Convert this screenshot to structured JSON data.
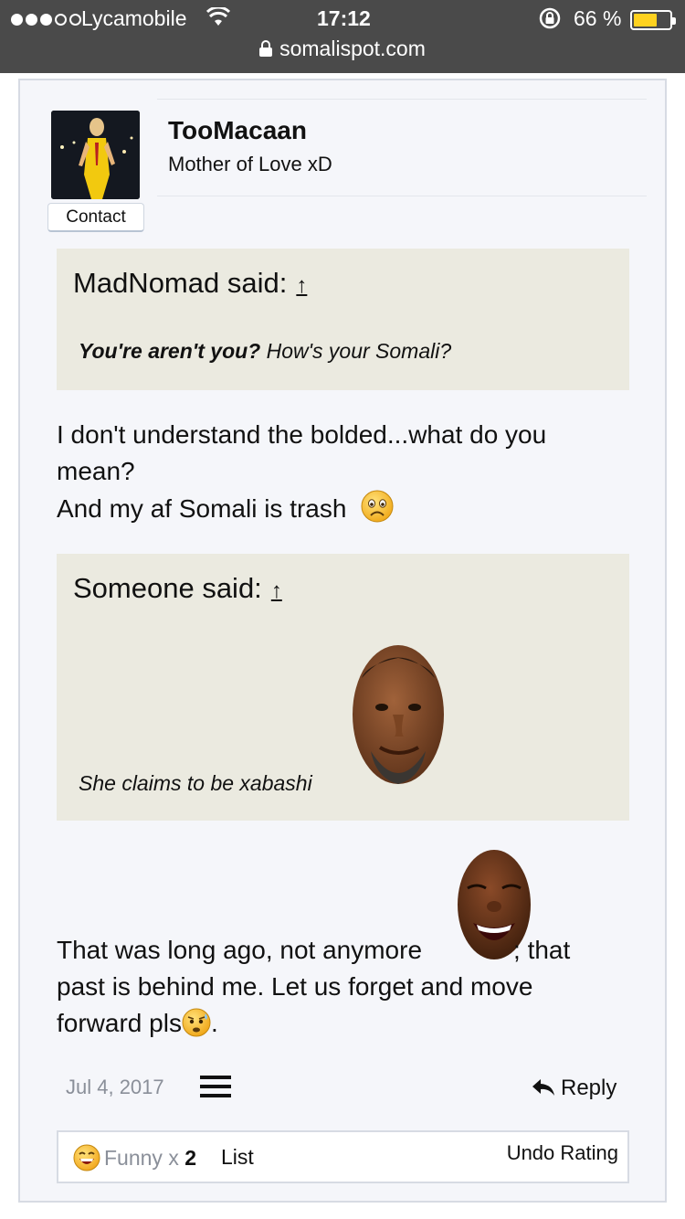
{
  "status_bar": {
    "carrier": "Lycamobile",
    "time": "17:12",
    "battery_percent": "66 %",
    "battery_level": 0.66,
    "url": "somalispot.com"
  },
  "author": {
    "name": "TooMacaan",
    "title": "Mother of Love xD",
    "contact_label": "Contact"
  },
  "quote1": {
    "header": "MadNomad said:",
    "arrow": "↑",
    "bold_text": "You're aren't you?",
    "text": " How's your Somali?"
  },
  "reply_text1": {
    "line1": "I don't understand the bolded...what do you",
    "line2": "mean?",
    "line3": "And my af Somali is trash"
  },
  "quote2": {
    "header": "Someone said:",
    "arrow": "↑",
    "text": "She claims to be xabashi"
  },
  "reply_text2": {
    "line1a": "That was long ago, not anymore",
    "line1b": "; that",
    "line2": "past is behind me. Let us forget and move",
    "line3a": "forward pls",
    "line3b": "."
  },
  "footer": {
    "date": "Jul 4, 2017",
    "reply_label": "Reply"
  },
  "ratings": {
    "label": "Funny x",
    "count": "2",
    "list_label": "List",
    "undo_label": "Undo Rating"
  },
  "colors": {
    "status_bar_bg": "#4a4a4a",
    "card_bg": "#f5f6fa",
    "quote_bg": "#ebeae0",
    "battery": "#ffd21f"
  }
}
